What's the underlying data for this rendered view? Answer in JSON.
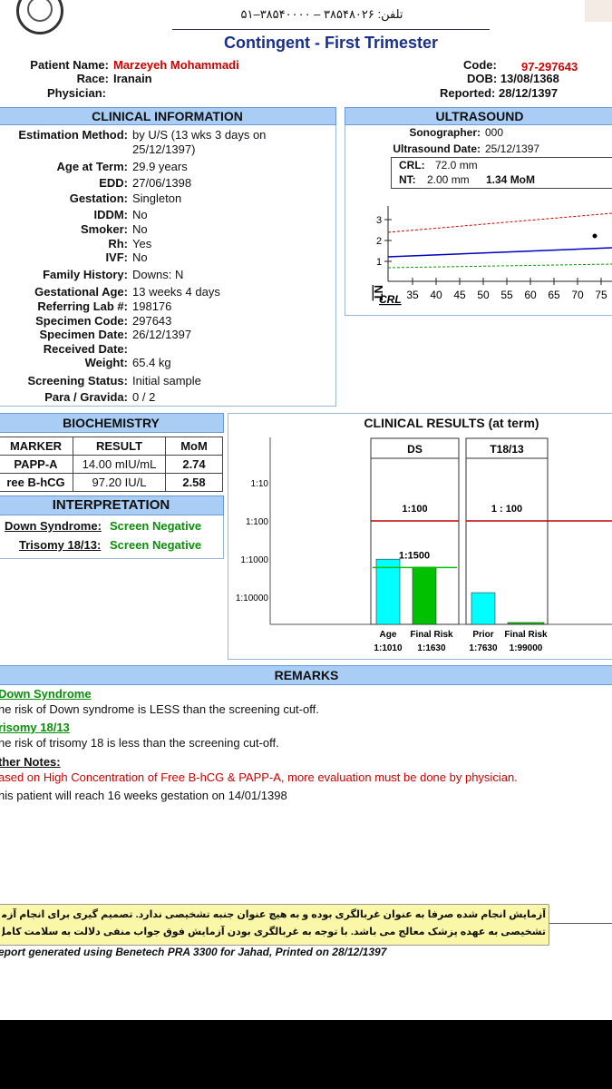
{
  "header": {
    "phone_line": "تلفن: ۳۸۵۴۸۰۲۶ – ۳۸۵۴۰۰۰۰–۵۱",
    "title": "Contingent - First Trimester"
  },
  "patient": {
    "name_label": "Patient Name:",
    "name": "Marzeyeh Mohammadi",
    "race_label": "Race:",
    "race": "Iranain",
    "physician_label": "Physician:",
    "code_label": "Code:",
    "code": "97-297643",
    "dob": "DOB: 13/08/1368",
    "reported": "Reported: 28/12/1397"
  },
  "clinical": {
    "header": "CLINICAL INFORMATION",
    "rows": [
      {
        "label": "Estimation Method:",
        "value": "by U/S (13 wks 3 days on"
      },
      {
        "label": "",
        "value": "25/12/1397)"
      },
      {
        "label": "Age at Term:",
        "value": "29.9 years"
      },
      {
        "label": "EDD:",
        "value": "27/06/1398"
      },
      {
        "label": "Gestation:",
        "value": "Singleton"
      },
      {
        "label": "IDDM:",
        "value": "No"
      },
      {
        "label": "Smoker:",
        "value": "No"
      },
      {
        "label": "Rh:",
        "value": "Yes"
      },
      {
        "label": "IVF:",
        "value": "No"
      },
      {
        "label": "Family History:",
        "value": "Downs: N"
      },
      {
        "label": "Gestational Age:",
        "value": "13 weeks 4 days"
      },
      {
        "label": "Referring Lab #:",
        "value": "198176"
      },
      {
        "label": "Specimen Code:",
        "value": "297643"
      },
      {
        "label": "Specimen Date:",
        "value": "26/12/1397"
      },
      {
        "label": "Received Date:",
        "value": ""
      },
      {
        "label": "Weight:",
        "value": "65.4 kg"
      },
      {
        "label": "Screening Status:",
        "value": "Initial sample"
      },
      {
        "label": "Para / Gravida:",
        "value": "0 / 2"
      }
    ]
  },
  "ultrasound": {
    "header": "ULTRASOUND",
    "sonographer_label": "Sonographer:",
    "sonographer": "000",
    "date_label": "Ultrasound Date:",
    "date": "25/12/1397",
    "crl_label": "CRL:",
    "crl": "72.0 mm",
    "nt_label": "NT:",
    "nt": "2.00 mm",
    "nt_mom": "1.34 MoM",
    "y_axis_label": "NT",
    "x_axis_label": "CRL",
    "y_ticks": [
      "1",
      "2",
      "3"
    ],
    "x_ticks": [
      "35",
      "40",
      "45",
      "50",
      "55",
      "60",
      "65",
      "70",
      "75"
    ]
  },
  "biochemistry": {
    "header": "BIOCHEMISTRY",
    "columns": [
      "MARKER",
      "RESULT",
      "MoM"
    ],
    "rows": [
      {
        "marker": "PAPP-A",
        "result": "14.00 mIU/mL",
        "mom": "2.74"
      },
      {
        "marker": "ree B-hCG",
        "result": "97.20 IU/L",
        "mom": "2.58"
      }
    ]
  },
  "interpretation": {
    "header": "INTERPRETATION",
    "down_label": "Down Syndrome:",
    "down_value": "Screen Negative",
    "trisomy_label": "Trisomy 18/13:",
    "trisomy_value": "Screen Negative"
  },
  "results": {
    "header": "CLINICAL RESULTS (at term)",
    "y_ticks": [
      "1:10",
      "1:100",
      "1:1000",
      "1:10000"
    ],
    "groups": [
      {
        "title": "DS",
        "cutoff_label": "1:100",
        "inner_label": "1:1500",
        "bars": [
          {
            "label": "Age",
            "value": "1:1010"
          },
          {
            "label": "Final Risk",
            "value": "1:1630"
          }
        ]
      },
      {
        "title": "T18/13",
        "cutoff_label": "1 : 100",
        "bars": [
          {
            "label": "Prior",
            "value": "1:7630"
          },
          {
            "label": "Final Risk",
            "value": "1:99000"
          }
        ]
      }
    ]
  },
  "chart_data": {
    "type": "bar",
    "title": "CLINICAL RESULTS (at term)",
    "y_scale": "log-odds (1:N)",
    "y_ticks": [
      "1:10",
      "1:100",
      "1:1000",
      "1:10000"
    ],
    "series": [
      {
        "name": "DS",
        "categories": [
          "Age",
          "Final Risk"
        ],
        "values": [
          1010,
          1630
        ],
        "cutoff": 100
      },
      {
        "name": "T18/13",
        "categories": [
          "Prior",
          "Final Risk"
        ],
        "values": [
          7630,
          99000
        ],
        "cutoff": 100
      }
    ],
    "colors": {
      "age": "#00ffff",
      "final": "#00c000",
      "cutoff": "#c00000"
    }
  },
  "remarks": {
    "header": "REMARKS",
    "ds_title": "Down Syndrome",
    "ds_text": "he risk of Down syndrome is LESS than the screening cut-off.",
    "tri_title": "risomy 18/13",
    "tri_text": "he risk of trisomy 18 is less than the screening cut-off.",
    "other_title": "ther Notes:",
    "other_red": "ased on High Concentration of Free B-hCG & PAPP-A, more evaluation must be done by physician.",
    "other_text": "his patient will reach 16 weeks gestation on 14/01/1398"
  },
  "footer": {
    "farsi_line1": "آزمایش انجام شده صرفا به عنوان غربالگری بوده و به هیچ عنوان جنبه تشخیصی ندارد. تصمیم گیری برای انجام آزمایش های قطعی و",
    "farsi_line2": "تشخیصی به عهده پزشک معالج می باشد. با توجه به غربالگری بودن آزمایش فوق جواب منفی دلالت به سلامت کامل جنین ندارد.",
    "generated": "eport generated using Benetech PRA 3300 for Jahad, Printed on 28/12/1397"
  }
}
